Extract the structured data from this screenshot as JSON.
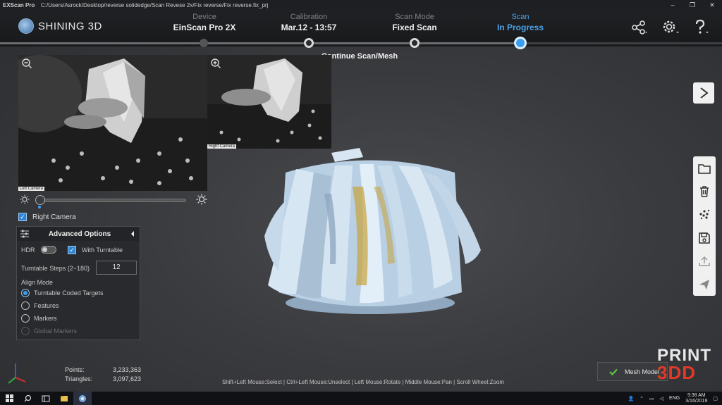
{
  "titlebar": {
    "app_name": "EXScan Pro",
    "path": "C:/Users/Asrock/Desktop/reverse solidedge/Scan Revese 2x/Fix reverse/Fix reverse.fix_prj",
    "minimize": "–",
    "maximize": "❐",
    "close": "✕"
  },
  "brand": {
    "name": "SHINING 3D"
  },
  "steps": [
    {
      "label": "Device",
      "value": "EinScan Pro 2X"
    },
    {
      "label": "Calibration",
      "value": "Mar.12 - 13:57"
    },
    {
      "label": "Scan Mode",
      "value": "Fixed Scan"
    },
    {
      "label": "Scan",
      "value": "In Progress"
    }
  ],
  "status_banner": "Continue Scan/Mesh",
  "cameras": {
    "left_label": "Left Camera",
    "right_label": "Right Camera"
  },
  "right_camera_checkbox": {
    "label": "Right Camera",
    "checked": true
  },
  "advanced_options": {
    "title": "Advanced Options",
    "hdr_label": "HDR",
    "hdr_on": false,
    "turntable_label": "With Turntable",
    "turntable_checked": true,
    "steps_label": "Turntable Steps (2~180)",
    "steps_value": "12",
    "align_mode_label": "Align Mode",
    "align_options": [
      {
        "label": "Turntable Coded Targets",
        "selected": true,
        "enabled": true
      },
      {
        "label": "Features",
        "selected": false,
        "enabled": true
      },
      {
        "label": "Markers",
        "selected": false,
        "enabled": true
      },
      {
        "label": "Global Markers",
        "selected": false,
        "enabled": false
      }
    ]
  },
  "stats": {
    "points_label": "Points:",
    "points_value": "3,233,363",
    "triangles_label": "Triangles:",
    "triangles_value": "3,097,623"
  },
  "mouse_hint": "Shift+Left Mouse:Select | Ctrl+Left Mouse:Unselect | Left Mouse:Rotate | Middle Mouse:Pan | Scroll Wheel:Zoom",
  "mesh_button": "Mesh Model",
  "watermark": {
    "line1": "PRINT",
    "line2": "3DD"
  },
  "taskbar": {
    "lang": "ENG",
    "time": "9:38 AM",
    "date": "3/16/2019"
  },
  "colors": {
    "accent": "#3a9ff0",
    "background": "#3a3b3e",
    "model": "#c6dcef"
  }
}
